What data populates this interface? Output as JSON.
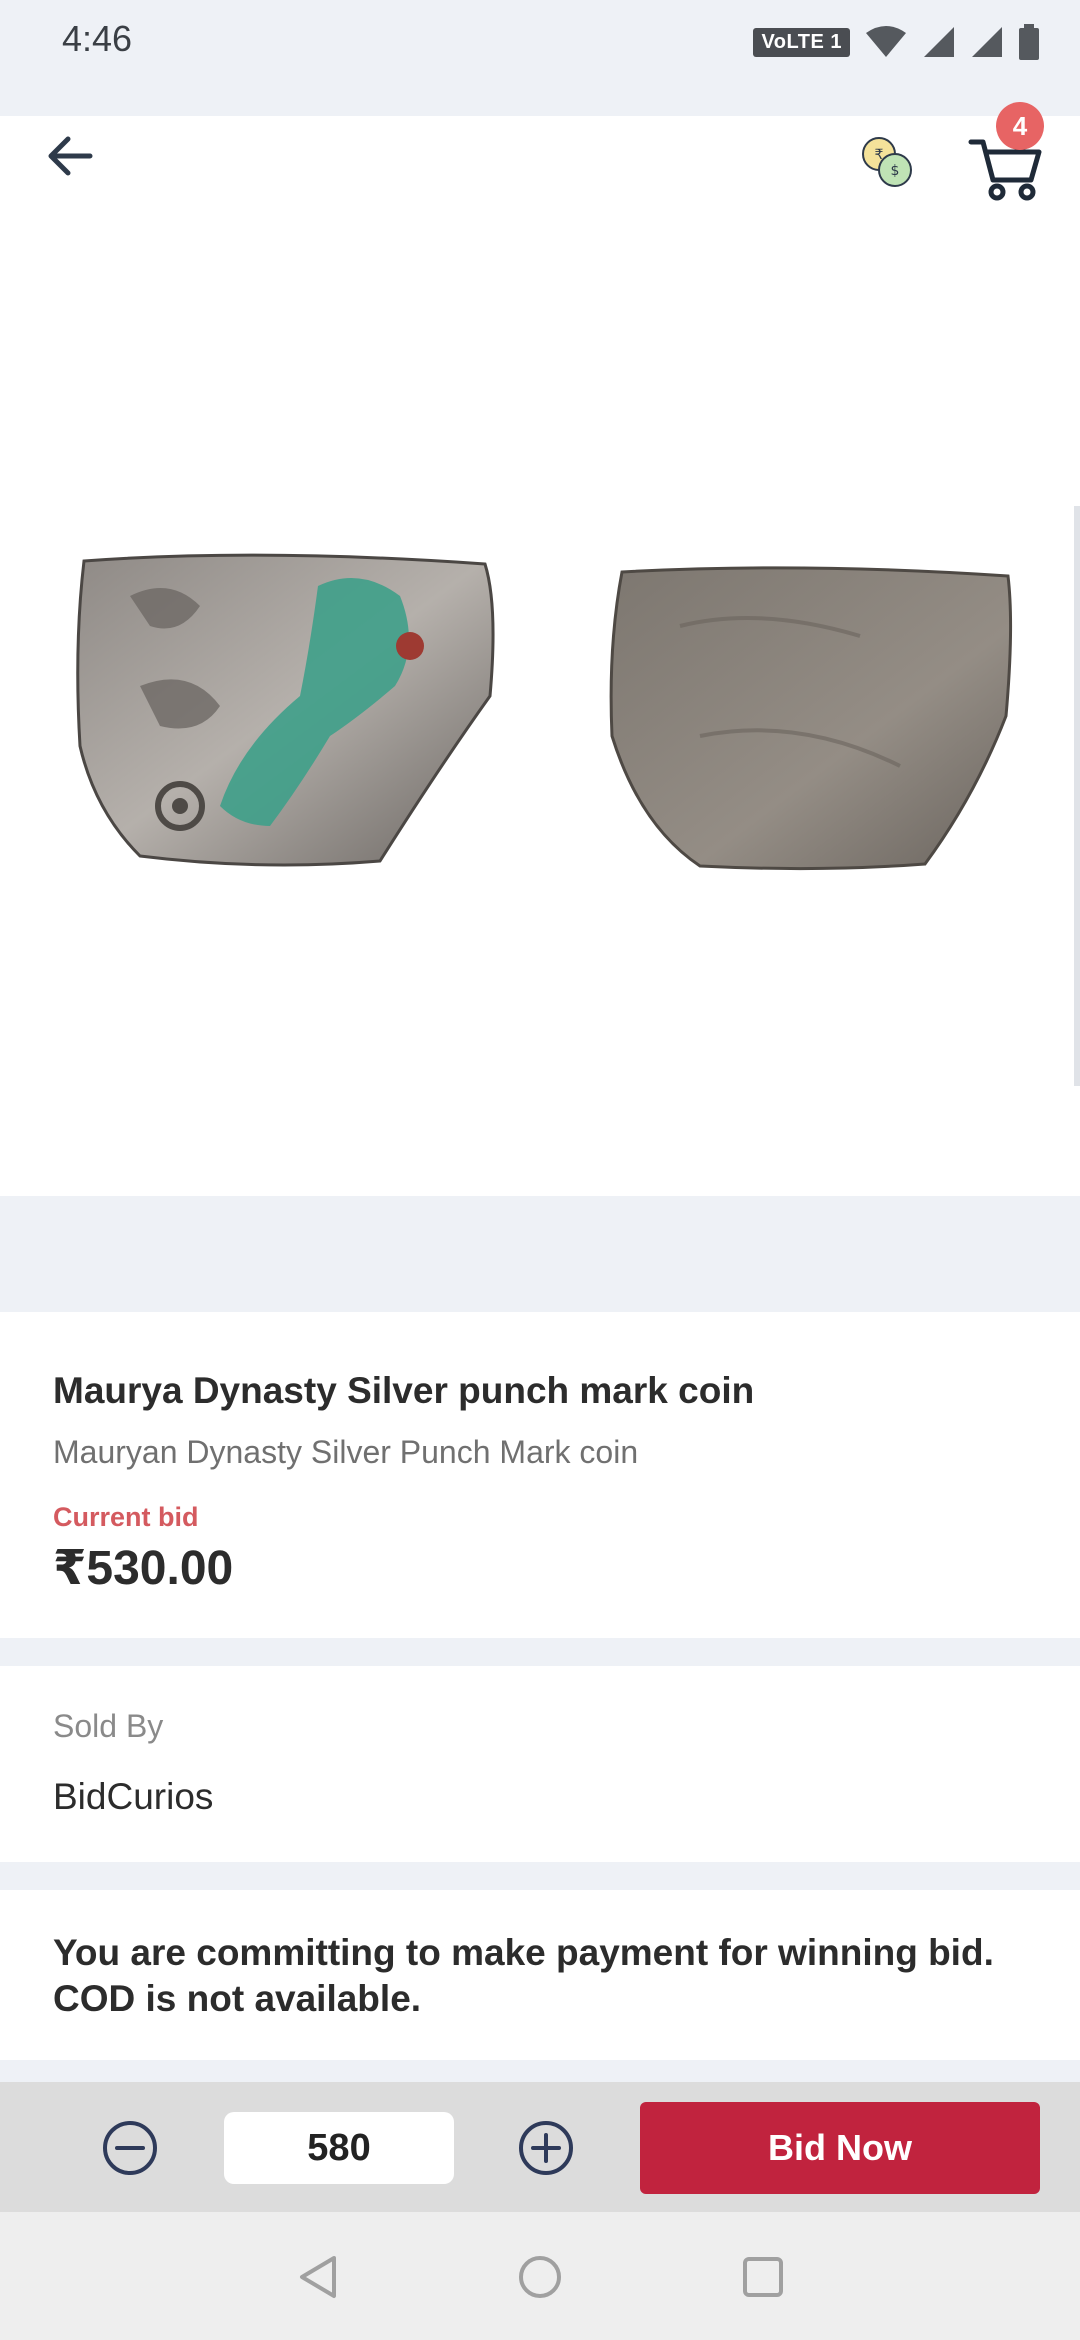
{
  "status_bar": {
    "time": "4:46",
    "network_badge": "VoLTE 1",
    "icons": [
      "wifi-icon",
      "signal-icon",
      "signal-icon",
      "battery-icon"
    ]
  },
  "header": {
    "back_icon": "arrow-left-icon",
    "currency_icon": "currency-exchange-icon",
    "cart_icon": "shopping-cart-icon",
    "cart_count": "4"
  },
  "product": {
    "title": "Maurya Dynasty Silver punch mark coin",
    "subtitle": "Mauryan Dynasty Silver Punch Mark coin",
    "current_bid_label": "Current bid",
    "current_bid_value": "₹530.00",
    "images": [
      "coin-obverse-image",
      "coin-reverse-image"
    ]
  },
  "seller": {
    "label": "Sold By",
    "name": "BidCurios"
  },
  "notice": {
    "text": "You are committing to make payment for winning bid. COD is not available."
  },
  "bid_bar": {
    "decrement_icon": "minus-circle-icon",
    "increment_icon": "plus-circle-icon",
    "bid_amount": "580",
    "bid_button_label": "Bid Now"
  },
  "colors": {
    "accent": "#c1233e",
    "badge": "#e76464",
    "bid_label": "#d45a5f"
  }
}
